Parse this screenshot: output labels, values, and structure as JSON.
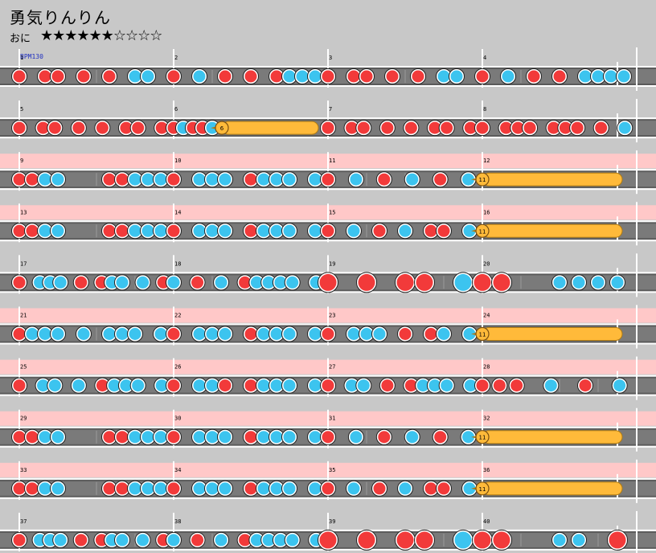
{
  "song": {
    "title": "勇気りんりん",
    "course": "おに",
    "stars": "★★★★★★☆☆☆☆",
    "bpm": "BPM130"
  },
  "colors": {
    "don": "#f23a3a",
    "ka": "#3cc4ef",
    "drumroll": "#ffba3a",
    "gogo_band": "#ffc8c8",
    "track": "#7a7a7a",
    "bg": "#c8c8c8"
  },
  "chart_data": {
    "type": "taiko-note-chart",
    "legend": {
      "d": "don (red)",
      "k": "ka (blue)",
      "D": "big don",
      "K": "big ka",
      "r": "drumroll start",
      "-": "rest"
    },
    "rows": [
      {
        "gogo": false,
        "measures": [
          {
            "num": "1",
            "notes": "d-dd-d-d-kk-"
          },
          {
            "num": "2",
            "notes": "d-k-d-d-dkkk"
          },
          {
            "num": "3",
            "notes": "d-dd-d-d-kk-"
          },
          {
            "num": "4",
            "notes": "d-k-d-d-kkkk"
          }
        ]
      },
      {
        "gogo": false,
        "measures": [
          {
            "num": "5",
            "notes": "d-dd-d-d-dd-d"
          },
          {
            "num": "6",
            "notes": "d-dd-r6"
          },
          {
            "num": "7",
            "notes": "d-dd-d-d-dd-d"
          },
          {
            "num": "8",
            "notes": "d-ddd-ddd-d-k"
          }
        ]
      },
      {
        "gogo": true,
        "measures": [
          {
            "num": "9",
            "notes": "ddkk---ddkkk"
          },
          {
            "num": "10",
            "notes": "d-kkk-dkkk-k"
          },
          {
            "num": "11",
            "notes": "d-k-d-k-d-k"
          },
          {
            "num": "12",
            "notes": "r11"
          }
        ]
      },
      {
        "gogo": true,
        "measures": [
          {
            "num": "13",
            "notes": "ddkk---ddkkk"
          },
          {
            "num": "14",
            "notes": "d-kkk-dkkk-k"
          },
          {
            "num": "15",
            "notes": "d-k-d-k-dd-k"
          },
          {
            "num": "16",
            "notes": "r11"
          }
        ]
      },
      {
        "gogo": false,
        "measures": [
          {
            "num": "17",
            "notes": "d-kkk-d-dkk-k-d"
          },
          {
            "num": "18",
            "notes": "k-d-k-dkkkk-k"
          },
          {
            "num": "19",
            "notes": "D-D-DD-K"
          },
          {
            "num": "20",
            "notes": "DD--kkkk"
          }
        ]
      },
      {
        "gogo": true,
        "measures": [
          {
            "num": "21",
            "notes": "dkkk-k-kkk-k"
          },
          {
            "num": "22",
            "notes": "d-kkk-dkkk-k"
          },
          {
            "num": "23",
            "notes": "d-kkk-d-dk-k"
          },
          {
            "num": "24",
            "notes": "r11"
          }
        ]
      },
      {
        "gogo": true,
        "measures": [
          {
            "num": "25",
            "notes": "d-kk-k-dkkk-k"
          },
          {
            "num": "26",
            "notes": "d-kkd-dkkk-k"
          },
          {
            "num": "27",
            "notes": "d-kk-d-dkkk-k"
          },
          {
            "num": "28",
            "notes": "ddd-k-d-k"
          }
        ]
      },
      {
        "gogo": true,
        "measures": [
          {
            "num": "29",
            "notes": "ddkk---ddkkk"
          },
          {
            "num": "30",
            "notes": "d-kkk-dkkk-k"
          },
          {
            "num": "31",
            "notes": "d-k-d-k-d-k"
          },
          {
            "num": "32",
            "notes": "r11"
          }
        ]
      },
      {
        "gogo": true,
        "measures": [
          {
            "num": "33",
            "notes": "ddkk---ddkkk"
          },
          {
            "num": "34",
            "notes": "d-kkk-dkkk-k"
          },
          {
            "num": "35",
            "notes": "d-k-d-k-dd-k"
          },
          {
            "num": "36",
            "notes": "r11"
          }
        ]
      },
      {
        "gogo": false,
        "measures": [
          {
            "num": "37",
            "notes": "d-kkk-d-dkk-k-d"
          },
          {
            "num": "38",
            "notes": "k-d-k-dkkkk-k"
          },
          {
            "num": "39",
            "notes": "D-D-DD-K"
          },
          {
            "num": "40",
            "notes": "DD--kk-D"
          }
        ]
      }
    ]
  }
}
